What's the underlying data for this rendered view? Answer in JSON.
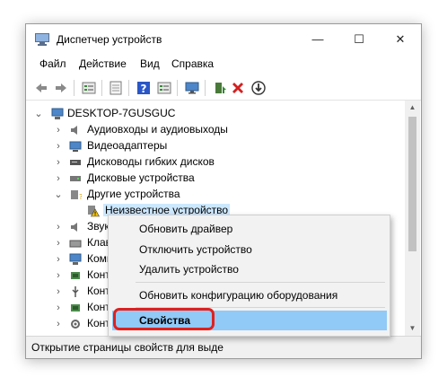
{
  "window": {
    "title": "Диспетчер устройств"
  },
  "window_controls": {
    "minimize": "—",
    "maximize": "☐",
    "close": "✕"
  },
  "menu": [
    "Файл",
    "Действие",
    "Вид",
    "Справка"
  ],
  "toolbar_icons": [
    "back-arrow-icon",
    "forward-arrow-icon",
    "properties-icon",
    "device-list-icon",
    "help-icon",
    "view-icon",
    "monitor-icon",
    "update-driver-icon",
    "uninstall-icon",
    "scan-download-icon"
  ],
  "tree": {
    "root": "DESKTOP-7GUSGUC",
    "items": [
      {
        "label": "Аудиовходы и аудиовыходы",
        "expander": "›"
      },
      {
        "label": "Видеоадаптеры",
        "expander": "›"
      },
      {
        "label": "Дисководы гибких дисков",
        "expander": "›"
      },
      {
        "label": "Дисковые устройства",
        "expander": "›"
      },
      {
        "label": "Другие устройства",
        "expander": "⌄"
      },
      {
        "label": "Неизвестное устройство",
        "expander": ""
      },
      {
        "label": "Звук",
        "expander": "›"
      },
      {
        "label": "Клав",
        "expander": "›"
      },
      {
        "label": "Комп",
        "expander": "›"
      },
      {
        "label": "Конт",
        "expander": "›"
      },
      {
        "label": "Конт",
        "expander": "›"
      },
      {
        "label": "Конт",
        "expander": "›"
      },
      {
        "label": "Конт",
        "expander": "›"
      }
    ],
    "root_expander": "⌄"
  },
  "context_menu": {
    "update_driver": "Обновить драйвер",
    "disable_device": "Отключить устройство",
    "uninstall_device": "Удалить устройство",
    "scan_hardware": "Обновить конфигурацию оборудования",
    "properties": "Свойства"
  },
  "status": "Открытие страницы свойств для выде",
  "colors": {
    "highlight": "#91c9f7",
    "selection": "#cce8ff",
    "ring": "#e0201e"
  }
}
